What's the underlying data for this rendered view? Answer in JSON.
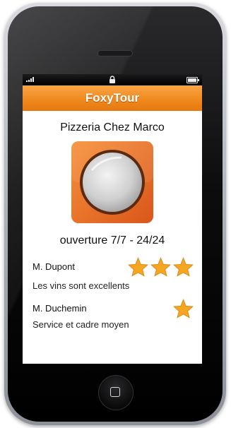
{
  "app": {
    "title": "FoxyTour"
  },
  "restaurant": {
    "name": "Pizzeria Chez Marco",
    "hours": "ouverture 7/7 - 24/24",
    "logo_icon": "plate-icon"
  },
  "reviews": [
    {
      "author": "M. Dupont",
      "comment": "Les vins sont excellents",
      "rating": 3
    },
    {
      "author": "M. Duchemin",
      "comment": "Service et cadre moyen",
      "rating": 1
    }
  ],
  "colors": {
    "accent": "#f08a1e",
    "star": "#f6a623",
    "logo": "#ea6a1c"
  }
}
